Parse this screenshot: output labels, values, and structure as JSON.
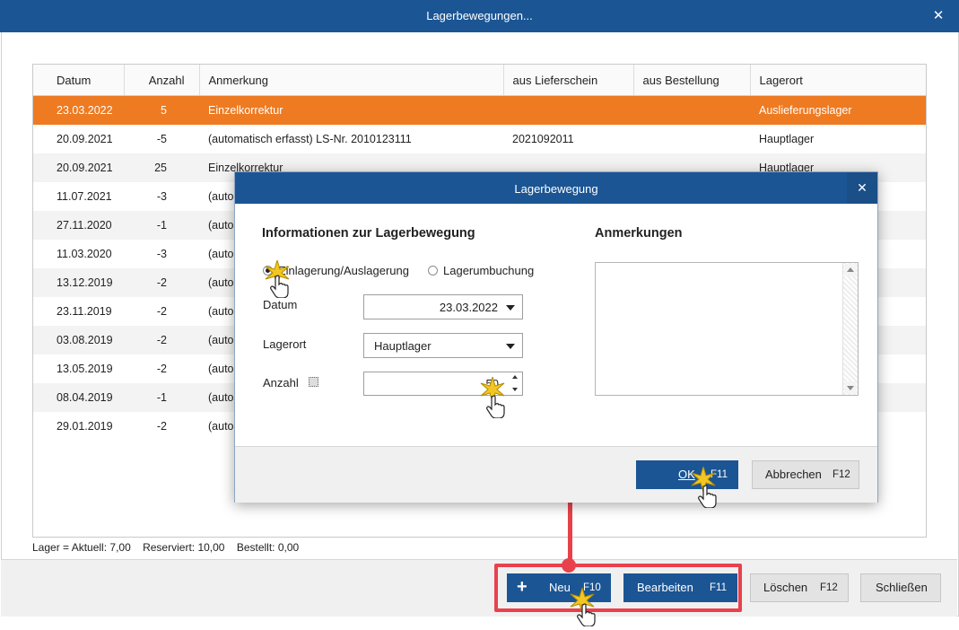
{
  "window": {
    "title": "Lagerbewegungen...",
    "close_label": "✕"
  },
  "grid": {
    "columns": [
      "Datum",
      "Anzahl",
      "Anmerkung",
      "aus Lieferschein",
      "aus Bestellung",
      "Lagerort"
    ],
    "rows": [
      {
        "datum": "23.03.2022",
        "anzahl": "5",
        "anmerkung": "Einzelkorrektur",
        "lieferschein": "",
        "bestellung": "",
        "lagerort": "Auslieferungslager"
      },
      {
        "datum": "20.09.2021",
        "anzahl": "-5",
        "anmerkung": "(automatisch erfasst) LS-Nr. 2010123111",
        "lieferschein": "2021092011",
        "bestellung": "",
        "lagerort": "Hauptlager"
      },
      {
        "datum": "20.09.2021",
        "anzahl": "25",
        "anmerkung": "Einzelkorrektur",
        "lieferschein": "",
        "bestellung": "",
        "lagerort": "Hauptlager"
      },
      {
        "datum": "11.07.2021",
        "anzahl": "-3",
        "anmerkung": "(auto",
        "lieferschein": "",
        "bestellung": "",
        "lagerort": ""
      },
      {
        "datum": "27.11.2020",
        "anzahl": "-1",
        "anmerkung": "(auto",
        "lieferschein": "",
        "bestellung": "",
        "lagerort": ""
      },
      {
        "datum": "11.03.2020",
        "anzahl": "-3",
        "anmerkung": "(auto",
        "lieferschein": "",
        "bestellung": "",
        "lagerort": ""
      },
      {
        "datum": "13.12.2019",
        "anzahl": "-2",
        "anmerkung": "(auto",
        "lieferschein": "",
        "bestellung": "",
        "lagerort": ""
      },
      {
        "datum": "23.11.2019",
        "anzahl": "-2",
        "anmerkung": "(auto",
        "lieferschein": "",
        "bestellung": "",
        "lagerort": ""
      },
      {
        "datum": "03.08.2019",
        "anzahl": "-2",
        "anmerkung": "(auto",
        "lieferschein": "",
        "bestellung": "",
        "lagerort": ""
      },
      {
        "datum": "13.05.2019",
        "anzahl": "-2",
        "anmerkung": "(auto",
        "lieferschein": "",
        "bestellung": "",
        "lagerort": ""
      },
      {
        "datum": "08.04.2019",
        "anzahl": "-1",
        "anmerkung": "(auto",
        "lieferschein": "",
        "bestellung": "",
        "lagerort": ""
      },
      {
        "datum": "29.01.2019",
        "anzahl": "-2",
        "anmerkung": "(auto",
        "lieferschein": "",
        "bestellung": "",
        "lagerort": ""
      }
    ]
  },
  "status": {
    "lager": "Lager = Aktuell: 7,00",
    "reserviert": "Reserviert: 10,00",
    "bestellt": "Bestellt: 0,00"
  },
  "buttons": {
    "neu": {
      "label": "Neu",
      "key": "F10",
      "icon": "plus-icon"
    },
    "bearbeiten": {
      "label": "Bearbeiten",
      "key": "F11"
    },
    "loeschen": {
      "label": "Löschen",
      "key": "F12"
    },
    "schliessen": {
      "label": "Schließen"
    }
  },
  "dialog": {
    "title": "Lagerbewegung",
    "close_label": "✕",
    "info_heading": "Informationen zur Lagerbewegung",
    "notes_heading": "Anmerkungen",
    "radio_in_out": "Einlagerung/Auslagerung",
    "radio_transfer": "Lagerumbuchung",
    "datum_label": "Datum",
    "datum_value": "23.03.2022",
    "lagerort_label": "Lagerort",
    "lagerort_value": "Hauptlager",
    "anzahl_label": "Anzahl",
    "anzahl_value": "50",
    "ok_label": "OK",
    "ok_key": "F11",
    "abbrechen_label": "Abbrechen",
    "abbrechen_key": "F12"
  },
  "colors": {
    "accent": "#1b5594",
    "selection": "#ee7a22",
    "highlight": "#e8414c"
  }
}
